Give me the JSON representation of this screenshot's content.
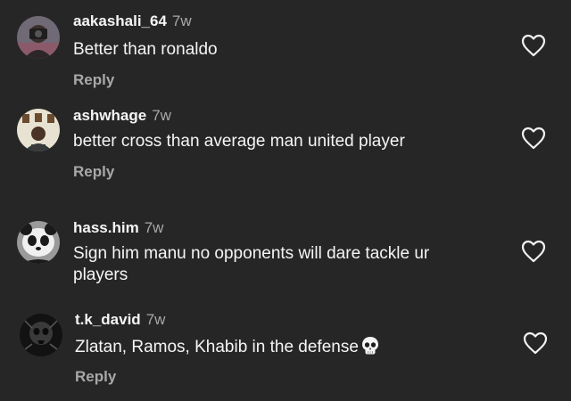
{
  "comments": [
    {
      "username": "aakashali_64",
      "time": "7w",
      "text": "Better than ronaldo",
      "reply_label": "Reply",
      "avatar_icon": "avatar-photo-person-camera"
    },
    {
      "username": "ashwhage",
      "time": "7w",
      "text": "better cross than average man united player",
      "reply_label": "Reply",
      "avatar_icon": "avatar-photo-person-frames"
    },
    {
      "username": "hass.him",
      "time": "7w",
      "text_line1": "Sign him manu no opponents will dare tackle ur",
      "text_line2": "players",
      "avatar_icon": "avatar-panda"
    },
    {
      "username": "t.k_david",
      "time": "7w",
      "text": "Zlatan, Ramos, Khabib in the defense",
      "emoji_icon": "skull-emoji-icon",
      "reply_label": "Reply",
      "avatar_icon": "avatar-dark-skull-art"
    }
  ],
  "like_icon": "heart-outline-icon",
  "colors": {
    "background": "#262626",
    "text": "#f5f5f5",
    "muted": "#a8a8a8"
  }
}
